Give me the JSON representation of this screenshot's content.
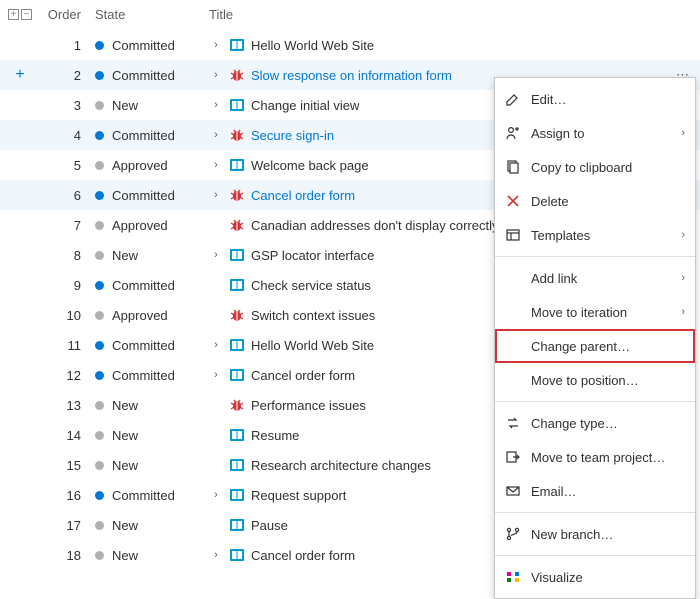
{
  "columns": {
    "order": "Order",
    "state": "State",
    "title": "Title"
  },
  "state_colors": {
    "Committed": "#0078d4",
    "New": "#b3b0ad",
    "Approved": "#b3b0ad"
  },
  "type_colors": {
    "pbi": "#009ccc",
    "bug": "#d13438"
  },
  "rows": [
    {
      "order": 1,
      "state": "Committed",
      "type": "pbi",
      "title": "Hello World Web Site",
      "chevron": true,
      "selected": false,
      "link": false,
      "actions": false,
      "add": false
    },
    {
      "order": 2,
      "state": "Committed",
      "type": "bug",
      "title": "Slow response on information form",
      "chevron": true,
      "selected": true,
      "link": true,
      "actions": true,
      "add": true
    },
    {
      "order": 3,
      "state": "New",
      "type": "pbi",
      "title": "Change initial view",
      "chevron": true,
      "selected": false,
      "link": false,
      "actions": false,
      "add": false
    },
    {
      "order": 4,
      "state": "Committed",
      "type": "bug",
      "title": "Secure sign-in",
      "chevron": true,
      "selected": true,
      "link": true,
      "actions": true,
      "add": false
    },
    {
      "order": 5,
      "state": "Approved",
      "type": "pbi",
      "title": "Welcome back page",
      "chevron": true,
      "selected": false,
      "link": false,
      "actions": false,
      "add": false
    },
    {
      "order": 6,
      "state": "Committed",
      "type": "bug",
      "title": "Cancel order form",
      "chevron": true,
      "selected": true,
      "link": true,
      "actions": true,
      "add": false
    },
    {
      "order": 7,
      "state": "Approved",
      "type": "bug",
      "title": "Canadian addresses don't display correctly",
      "chevron": false,
      "selected": false,
      "link": false,
      "actions": false,
      "add": false
    },
    {
      "order": 8,
      "state": "New",
      "type": "pbi",
      "title": "GSP locator interface",
      "chevron": true,
      "selected": false,
      "link": false,
      "actions": false,
      "add": false
    },
    {
      "order": 9,
      "state": "Committed",
      "type": "pbi",
      "title": "Check service status",
      "chevron": false,
      "selected": false,
      "link": false,
      "actions": false,
      "add": false
    },
    {
      "order": 10,
      "state": "Approved",
      "type": "bug",
      "title": "Switch context issues",
      "chevron": false,
      "selected": false,
      "link": false,
      "actions": false,
      "add": false
    },
    {
      "order": 11,
      "state": "Committed",
      "type": "pbi",
      "title": "Hello World Web Site",
      "chevron": true,
      "selected": false,
      "link": false,
      "actions": false,
      "add": false
    },
    {
      "order": 12,
      "state": "Committed",
      "type": "pbi",
      "title": "Cancel order form",
      "chevron": true,
      "selected": false,
      "link": false,
      "actions": false,
      "add": false
    },
    {
      "order": 13,
      "state": "New",
      "type": "bug",
      "title": "Performance issues",
      "chevron": false,
      "selected": false,
      "link": false,
      "actions": false,
      "add": false
    },
    {
      "order": 14,
      "state": "New",
      "type": "pbi",
      "title": "Resume",
      "chevron": false,
      "selected": false,
      "link": false,
      "actions": false,
      "add": false
    },
    {
      "order": 15,
      "state": "New",
      "type": "pbi",
      "title": "Research architecture changes",
      "chevron": false,
      "selected": false,
      "link": false,
      "actions": false,
      "add": false
    },
    {
      "order": 16,
      "state": "Committed",
      "type": "pbi",
      "title": "Request support",
      "chevron": true,
      "selected": false,
      "link": false,
      "actions": false,
      "add": false
    },
    {
      "order": 17,
      "state": "New",
      "type": "pbi",
      "title": "Pause",
      "chevron": false,
      "selected": false,
      "link": false,
      "actions": false,
      "add": false
    },
    {
      "order": 18,
      "state": "New",
      "type": "pbi",
      "title": "Cancel order form",
      "chevron": true,
      "selected": false,
      "link": false,
      "actions": false,
      "add": false
    }
  ],
  "menu": [
    {
      "kind": "item",
      "icon": "edit",
      "label": "Edit…",
      "sub": false
    },
    {
      "kind": "item",
      "icon": "assign",
      "label": "Assign to",
      "sub": true
    },
    {
      "kind": "item",
      "icon": "copy",
      "label": "Copy to clipboard",
      "sub": false
    },
    {
      "kind": "item",
      "icon": "delete",
      "label": "Delete",
      "sub": false,
      "red": true
    },
    {
      "kind": "item",
      "icon": "templates",
      "label": "Templates",
      "sub": true
    },
    {
      "kind": "sep"
    },
    {
      "kind": "item",
      "icon": "",
      "label": "Add link",
      "sub": true
    },
    {
      "kind": "item",
      "icon": "",
      "label": "Move to iteration",
      "sub": true
    },
    {
      "kind": "item",
      "icon": "",
      "label": "Change parent…",
      "sub": false,
      "highlight": true
    },
    {
      "kind": "item",
      "icon": "",
      "label": "Move to position…",
      "sub": false
    },
    {
      "kind": "sep"
    },
    {
      "kind": "item",
      "icon": "changetype",
      "label": "Change type…",
      "sub": false
    },
    {
      "kind": "item",
      "icon": "move",
      "label": "Move to team project…",
      "sub": false
    },
    {
      "kind": "item",
      "icon": "email",
      "label": "Email…",
      "sub": false
    },
    {
      "kind": "sep"
    },
    {
      "kind": "item",
      "icon": "branch",
      "label": "New branch…",
      "sub": false
    },
    {
      "kind": "sep"
    },
    {
      "kind": "item",
      "icon": "visualize",
      "label": "Visualize",
      "sub": false
    }
  ]
}
